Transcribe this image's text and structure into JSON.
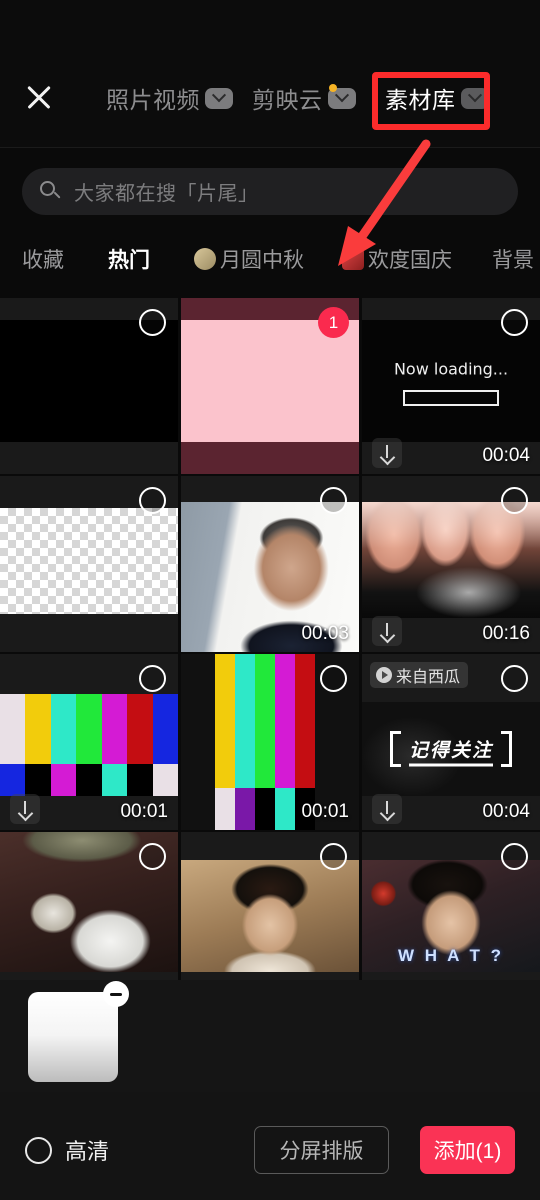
{
  "header": {
    "close_icon": "close-icon",
    "tabs": [
      {
        "label": "照片视频",
        "has_chevron": true,
        "has_dot": false,
        "active": false
      },
      {
        "label": "剪映云",
        "has_chevron": true,
        "has_dot": true,
        "active": false
      },
      {
        "label": "素材库",
        "has_chevron": true,
        "has_dot": false,
        "active": true
      }
    ]
  },
  "annotation": {
    "highlight_color": "#fc2b2b",
    "arrow_color": "#fa3c3c",
    "target": "素材库"
  },
  "search": {
    "icon": "search-icon",
    "placeholder": "大家都在搜「片尾」",
    "value": ""
  },
  "categories": [
    {
      "label": "收藏",
      "active": false,
      "icon": ""
    },
    {
      "label": "热门",
      "active": true,
      "icon": ""
    },
    {
      "label": "月圆中秋",
      "active": false,
      "icon": "moon"
    },
    {
      "label": "欢度国庆",
      "active": false,
      "icon": "flag"
    },
    {
      "label": "背景",
      "active": false,
      "icon": ""
    }
  ],
  "grid": {
    "rows": [
      [
        {
          "kind": "black",
          "duration": "",
          "selected": false,
          "badge": "",
          "downloadable": false,
          "source": ""
        },
        {
          "kind": "pink",
          "duration": "",
          "selected": true,
          "badge": "1",
          "downloadable": false,
          "source": ""
        },
        {
          "kind": "loading",
          "duration": "00:04",
          "selected": false,
          "badge": "",
          "downloadable": true,
          "source": "",
          "text": "Now loading..."
        }
      ],
      [
        {
          "kind": "checker",
          "duration": "",
          "selected": false,
          "badge": "",
          "downloadable": false,
          "source": ""
        },
        {
          "kind": "person",
          "duration": "00:03",
          "selected": false,
          "badge": "",
          "downloadable": false,
          "source": ""
        },
        {
          "kind": "smoke",
          "duration": "00:16",
          "selected": false,
          "badge": "",
          "downloadable": true,
          "source": ""
        }
      ],
      [
        {
          "kind": "colorbars-h",
          "duration": "00:01",
          "selected": false,
          "badge": "",
          "downloadable": true,
          "source": ""
        },
        {
          "kind": "colorbars-v",
          "duration": "00:01",
          "selected": false,
          "badge": "",
          "downloadable": false,
          "source": ""
        },
        {
          "kind": "follow",
          "duration": "00:04",
          "selected": false,
          "badge": "",
          "downloadable": true,
          "source": "来自西瓜",
          "text": "记得关注"
        }
      ],
      [
        {
          "kind": "duck",
          "duration": "",
          "selected": false,
          "badge": "",
          "downloadable": false,
          "source": ""
        },
        {
          "kind": "kid",
          "duration": "",
          "selected": false,
          "badge": "",
          "downloadable": false,
          "source": ""
        },
        {
          "kind": "what",
          "duration": "",
          "selected": false,
          "badge": "",
          "downloadable": false,
          "source": "",
          "text": "W H A T ?"
        }
      ]
    ]
  },
  "strip": {
    "items": [
      {
        "remove_label": "−"
      }
    ]
  },
  "footer": {
    "hd_label": "高清",
    "hd_checked": false,
    "split_label": "分屏排版",
    "add_label": "添加(1)",
    "add_color": "#fa3355"
  }
}
